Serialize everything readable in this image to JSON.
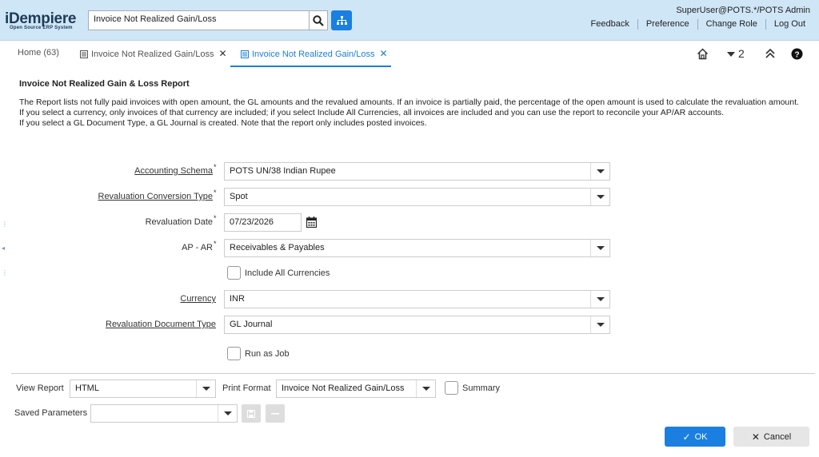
{
  "colors": {
    "header_bg": "#cfe6f7",
    "accent": "#1a7fe0",
    "cancel_bg": "#e6e6e6"
  },
  "header": {
    "logo_text": "iDempiere",
    "logo_subtext": "Open Source ERP System",
    "search_value": "Invoice Not Realized Gain/Loss",
    "user": "SuperUser@POTS.*/POTS Admin",
    "links": {
      "feedback": "Feedback",
      "preference": "Preference",
      "change_role": "Change Role",
      "logout": "Log Out"
    }
  },
  "tabs": {
    "home": "Home (63)",
    "tab1": "Invoice Not Realized Gain/Loss",
    "tab2": "Invoice Not Realized Gain/Loss",
    "dropdown_count": "2"
  },
  "process": {
    "title": "Invoice Not Realized Gain & Loss Report",
    "desc1": "The Report lists not fully paid invoices with open amount, the GL amounts and the revalued amounts.  If an invoice is partially paid, the percentage of the open amount is used to calculate the revaluation amount.",
    "desc2": "If you select a currency, only invoices of that currency are included; if you select Include All Currencies, all invoices are included and you can use the report to reconcile your AP/AR accounts.",
    "desc3": "If you select a GL Document Type, a GL Journal is created. Note that the report only includes posted invoices."
  },
  "fields": {
    "accounting_schema": {
      "label": "Accounting Schema",
      "value": "POTS UN/38 Indian Rupee"
    },
    "conversion_type": {
      "label": "Revaluation Conversion Type",
      "value": "Spot"
    },
    "revaluation_date": {
      "label": "Revaluation Date",
      "value": "07/23/2026"
    },
    "ap_ar": {
      "label": "AP - AR",
      "value": "Receivables & Payables"
    },
    "include_all_currencies": {
      "label": "Include All Currencies"
    },
    "currency": {
      "label": "Currency",
      "value": "INR"
    },
    "doc_type": {
      "label": "Revaluation Document Type",
      "value": "GL Journal"
    },
    "run_as_job": {
      "label": "Run as Job"
    }
  },
  "footer": {
    "view_report_label": "View Report",
    "view_report_value": "HTML",
    "print_format_label": "Print Format",
    "print_format_value": "Invoice Not Realized Gain/Loss",
    "summary_label": "Summary",
    "saved_params_label": "Saved Parameters",
    "saved_params_value": "",
    "ok_label": "OK",
    "cancel_label": "Cancel"
  },
  "required_mark": "*"
}
